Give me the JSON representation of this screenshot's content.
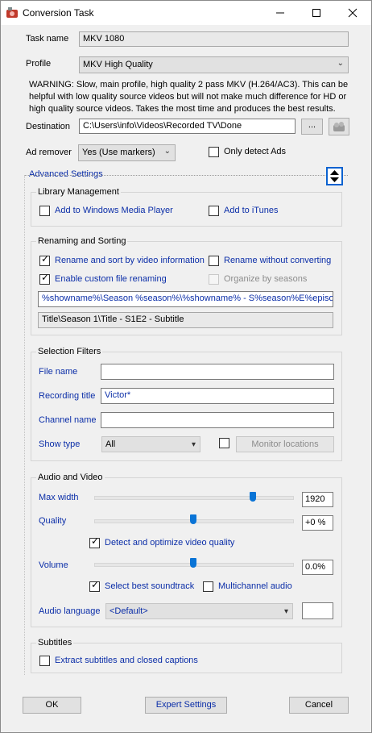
{
  "window": {
    "title": "Conversion Task"
  },
  "task": {
    "name_label": "Task name",
    "name_value": "MKV 1080"
  },
  "profile": {
    "label": "Profile",
    "value": "MKV High Quality",
    "warning": "WARNING: Slow, main profile, high quality 2 pass MKV (H.264/AC3).  This can be helpful with low quality source videos but will not make much difference for HD or high quality source videos. Takes the most time and produces the best results."
  },
  "destination": {
    "label": "Destination",
    "value": "C:\\Users\\info\\Videos\\Recorded TV\\Done",
    "browse_label": "..."
  },
  "ad_remover": {
    "label": "Ad remover",
    "value": "Yes (Use markers)",
    "only_detect_label": "Only detect Ads"
  },
  "advanced": {
    "label": "Advanced Settings"
  },
  "library": {
    "title": "Library Management",
    "wmp_label": "Add to Windows Media Player",
    "itunes_label": "Add to iTunes"
  },
  "renaming": {
    "title": "Renaming and Sorting",
    "rename_sort_label": "Rename and sort by video information",
    "rename_no_convert_label": "Rename without converting",
    "custom_label": "Enable custom file renaming",
    "organize_label": "Organize by seasons",
    "pattern_value": "%showname%\\Season %season%\\%showname% - S%season%E%episode%",
    "preview_value": "Title\\Season 1\\Title - S1E2 - Subtitle"
  },
  "filters": {
    "title": "Selection Filters",
    "file_name_label": "File name",
    "file_name_value": "",
    "recording_title_label": "Recording title",
    "recording_title_value": "Victor*",
    "channel_name_label": "Channel name",
    "channel_name_value": "",
    "show_type_label": "Show type",
    "show_type_value": "All",
    "monitor_label": "Monitor locations"
  },
  "av": {
    "title": "Audio and Video",
    "max_width_label": "Max width",
    "max_width_value": "1920",
    "max_width_level": 0.8,
    "quality_label": "Quality",
    "quality_value": "+0 %",
    "quality_level": 0.5,
    "detect_label": "Detect and optimize video quality",
    "volume_label": "Volume",
    "volume_value": "0.0%",
    "volume_level": 0.5,
    "soundtrack_label": "Select best soundtrack",
    "multichannel_label": "Multichannel audio",
    "audio_language_label": "Audio language",
    "audio_language_value": "<Default>",
    "audio_language_code": ""
  },
  "subtitles": {
    "title": "Subtitles",
    "extract_label": "Extract subtitles and closed captions"
  },
  "buttons": {
    "ok": "OK",
    "expert": "Expert Settings",
    "cancel": "Cancel"
  }
}
